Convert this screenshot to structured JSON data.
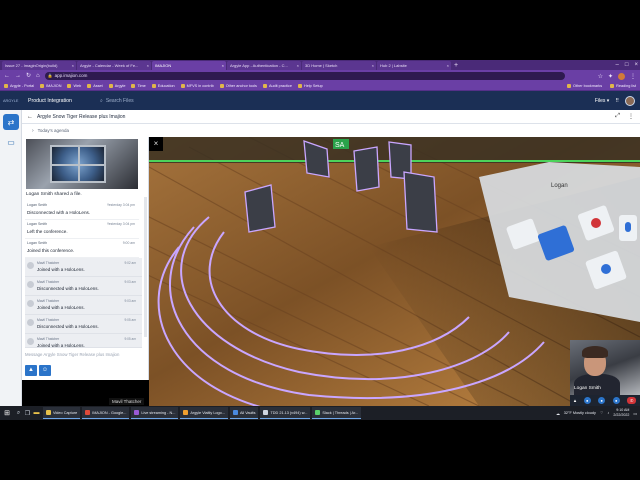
{
  "browser": {
    "tabs": [
      {
        "label": "Issue 27 - ImaginOrigin(build)",
        "active": false
      },
      {
        "label": "Argyle - Calendar - Week of Fe...",
        "active": false
      },
      {
        "label": "IMAJION",
        "active": true
      },
      {
        "label": "Argyle App - Authentication - C...",
        "active": false
      },
      {
        "label": "3D Home | Sketch",
        "active": false
      },
      {
        "label": "Hub 2 | Labsite",
        "active": false
      }
    ],
    "new_tab": "+",
    "url": "app.imajion.com",
    "bookmarks": [
      "Argyle - Portal",
      "IMAJION",
      "Web",
      "Asset",
      "Argyle",
      "Time",
      "Education",
      "MFVS in contrib",
      "Other anchor tools",
      "Audit practice",
      "Help Setup"
    ],
    "bookmarks_right": [
      "Other bookmarks",
      "Reading list"
    ]
  },
  "app": {
    "brand": "ARGYLE",
    "product": "Product Integration",
    "search_placeholder": "Search Files",
    "files_label": "Files"
  },
  "conversation": {
    "title": "Argyle Snow Tiger Release plus Imajion",
    "agenda": "Today's agenda"
  },
  "chat": {
    "shared_text": "Logan Smith  shared a file.",
    "messages": [
      {
        "who": "Logan Smith",
        "when": "Yesterday 3:04 pm",
        "text": "Disconnected with a HoloLens."
      },
      {
        "who": "Logan Smith",
        "when": "Yesterday 3:04 pm",
        "text": "Left the conference."
      },
      {
        "who": "Logan Smith",
        "when": "9:00 am",
        "text": "Joined this conference."
      }
    ],
    "system_messages": [
      {
        "who": "Mavil Thatcher",
        "when": "9:02 am",
        "text": "Joined with a HoloLens."
      },
      {
        "who": "Mavil Thatcher",
        "when": "9:03 am",
        "text": "Disconnected with a HoloLens."
      },
      {
        "who": "Mavil Thatcher",
        "when": "9:03 am",
        "text": "Joined with a HoloLens."
      },
      {
        "who": "Mavil Thatcher",
        "when": "9:05 am",
        "text": "Disconnected with a HoloLens."
      },
      {
        "who": "Mavil Thatcher",
        "when": "9:05 am",
        "text": "Joined with a HoloLens."
      }
    ],
    "input_placeholder": "Message Argyle Snow Tiger Release plus Imajion"
  },
  "video": {
    "remote_name": "Mavil Thatcher",
    "local_name": "Logan Smith",
    "hud_button_label": "Logan",
    "sign_text": "SA"
  },
  "taskbar": {
    "apps": [
      "Video Capture",
      "IMAJION - Google...",
      "Live streaming - N...",
      "Argyle Vialtly Logo...",
      "All Vaults",
      "TDD 21.13 (v494) w...",
      "Slack | Threads | Ar..."
    ],
    "weather": "32°F  Mostly cloudy",
    "time": "9:10 AM",
    "date": "2/22/2022"
  },
  "colors": {
    "tab_bar": "#4a2a78",
    "address_bar": "#6a3fa5",
    "app_header": "#1b2f55",
    "accent": "#2b74c9",
    "hologram_outline": "#c9a6ff",
    "end_call": "#d13438"
  }
}
